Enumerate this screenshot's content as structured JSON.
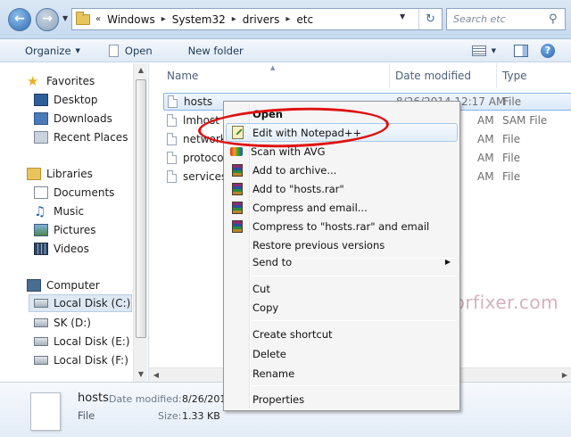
{
  "address_bar": {
    "back_icon": "back-arrow-icon",
    "forward_icon": "forward-arrow-icon",
    "overflow_chevron": "«",
    "breadcrumbs": [
      "Windows",
      "System32",
      "drivers",
      "etc"
    ],
    "search_placeholder": "Search etc"
  },
  "toolbar": {
    "organize": "Organize",
    "open": "Open",
    "new_folder": "New folder"
  },
  "navpane": {
    "favorites": {
      "header": "Favorites",
      "items": [
        "Desktop",
        "Downloads",
        "Recent Places"
      ]
    },
    "libraries": {
      "header": "Libraries",
      "items": [
        "Documents",
        "Music",
        "Pictures",
        "Videos"
      ]
    },
    "computer": {
      "header": "Computer",
      "items": [
        "Local Disk (C:)",
        "SK (D:)",
        "Local Disk (E:)",
        "Local Disk (F:)"
      ],
      "selected": "Local Disk (C:)"
    }
  },
  "filelist": {
    "columns": [
      "Name",
      "Date modified",
      "Type"
    ],
    "rows": [
      {
        "name": "hosts",
        "date": "8/26/2014 12:17 AM",
        "type": "File"
      },
      {
        "name": "lmhost",
        "date": "AM",
        "type": "SAM File"
      },
      {
        "name": "network",
        "date": "AM",
        "type": "File"
      },
      {
        "name": "protocol",
        "date": "AM",
        "type": "File"
      },
      {
        "name": "services",
        "date": "AM",
        "type": "File"
      }
    ],
    "selected_row": "hosts"
  },
  "context_menu": {
    "items": [
      {
        "label": "Open",
        "bold": true,
        "icon": "none"
      },
      {
        "label": "Edit with Notepad++",
        "icon": "notepad-plus-plus-icon",
        "highlighted": true
      },
      {
        "label": "Scan with AVG",
        "icon": "avg-icon"
      },
      {
        "label": "Add to archive...",
        "icon": "winrar-icon"
      },
      {
        "label": "Add to \"hosts.rar\"",
        "icon": "winrar-icon"
      },
      {
        "label": "Compress and email...",
        "icon": "winrar-icon"
      },
      {
        "label": "Compress to \"hosts.rar\" and email",
        "icon": "winrar-icon"
      },
      {
        "label": "Restore previous versions",
        "icon": "none"
      },
      {
        "label": "Send to",
        "icon": "none",
        "submenu": true
      },
      {
        "label": "Cut",
        "icon": "none"
      },
      {
        "label": "Copy",
        "icon": "none"
      },
      {
        "label": "Create shortcut",
        "icon": "none"
      },
      {
        "label": "Delete",
        "icon": "none"
      },
      {
        "label": "Rename",
        "icon": "none"
      },
      {
        "label": "Properties",
        "icon": "none"
      }
    ]
  },
  "details": {
    "name": "hosts",
    "type": "File",
    "modified_label": "Date modified:",
    "modified_value": "8/26/201",
    "size_label": "Size:",
    "size_value": "1.33 KB"
  },
  "watermark": "www.pcmobileerrorfixer.com",
  "colors": {
    "highlight_ellipse": "#e01010",
    "selection": "#dbe9f9"
  }
}
